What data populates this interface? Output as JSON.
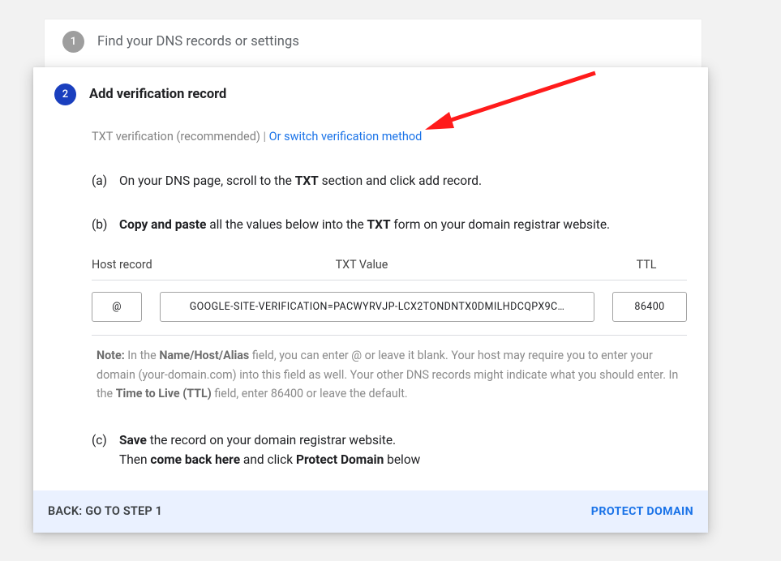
{
  "step1": {
    "number": "1",
    "title": "Find your DNS records or settings"
  },
  "step2": {
    "number": "2",
    "title": "Add verification record",
    "sub_prefix": "TXT verification (recommended)",
    "sub_sep": " | ",
    "switch_link": "Or switch verification method"
  },
  "items": {
    "a": {
      "label": "(a)",
      "pre": "On your DNS page, scroll to the ",
      "bold": "TXT",
      "post": " section and click add record."
    },
    "b": {
      "label": "(b)",
      "bold1": "Copy and paste",
      "mid": " all the values below into the ",
      "bold2": "TXT",
      "post": " form on your domain registrar website."
    },
    "c": {
      "label": "(c)",
      "s1_bold": "Save",
      "s1_post": " the record on your domain registrar website.",
      "s2_pre": "Then ",
      "s2_bold1": "come back here",
      "s2_mid": " and click ",
      "s2_bold2": "Protect Domain",
      "s2_post": " below"
    }
  },
  "dns": {
    "h_host": "Host record",
    "h_txt": "TXT Value",
    "h_ttl": "TTL",
    "host": "@",
    "txt": "GOOGLE-SITE-VERIFICATION=PACWYRVJP-LCX2TONDNTX0DMILHDCQPX9C…",
    "ttl": "86400"
  },
  "note": {
    "lead": "Note:",
    "p1_a": " In the ",
    "p1_bold1": "Name/Host/Alias",
    "p1_b": " field, you can enter @ or leave it blank. Your host may require you to enter your domain (your-domain.com) into this field as well. Your other DNS records might indicate what you should enter. In the ",
    "p1_bold2": "Time to Live (TTL)",
    "p1_c": " field, enter 86400 or leave the default."
  },
  "footer": {
    "back": "BACK: GO TO STEP 1",
    "protect": "PROTECT DOMAIN"
  }
}
